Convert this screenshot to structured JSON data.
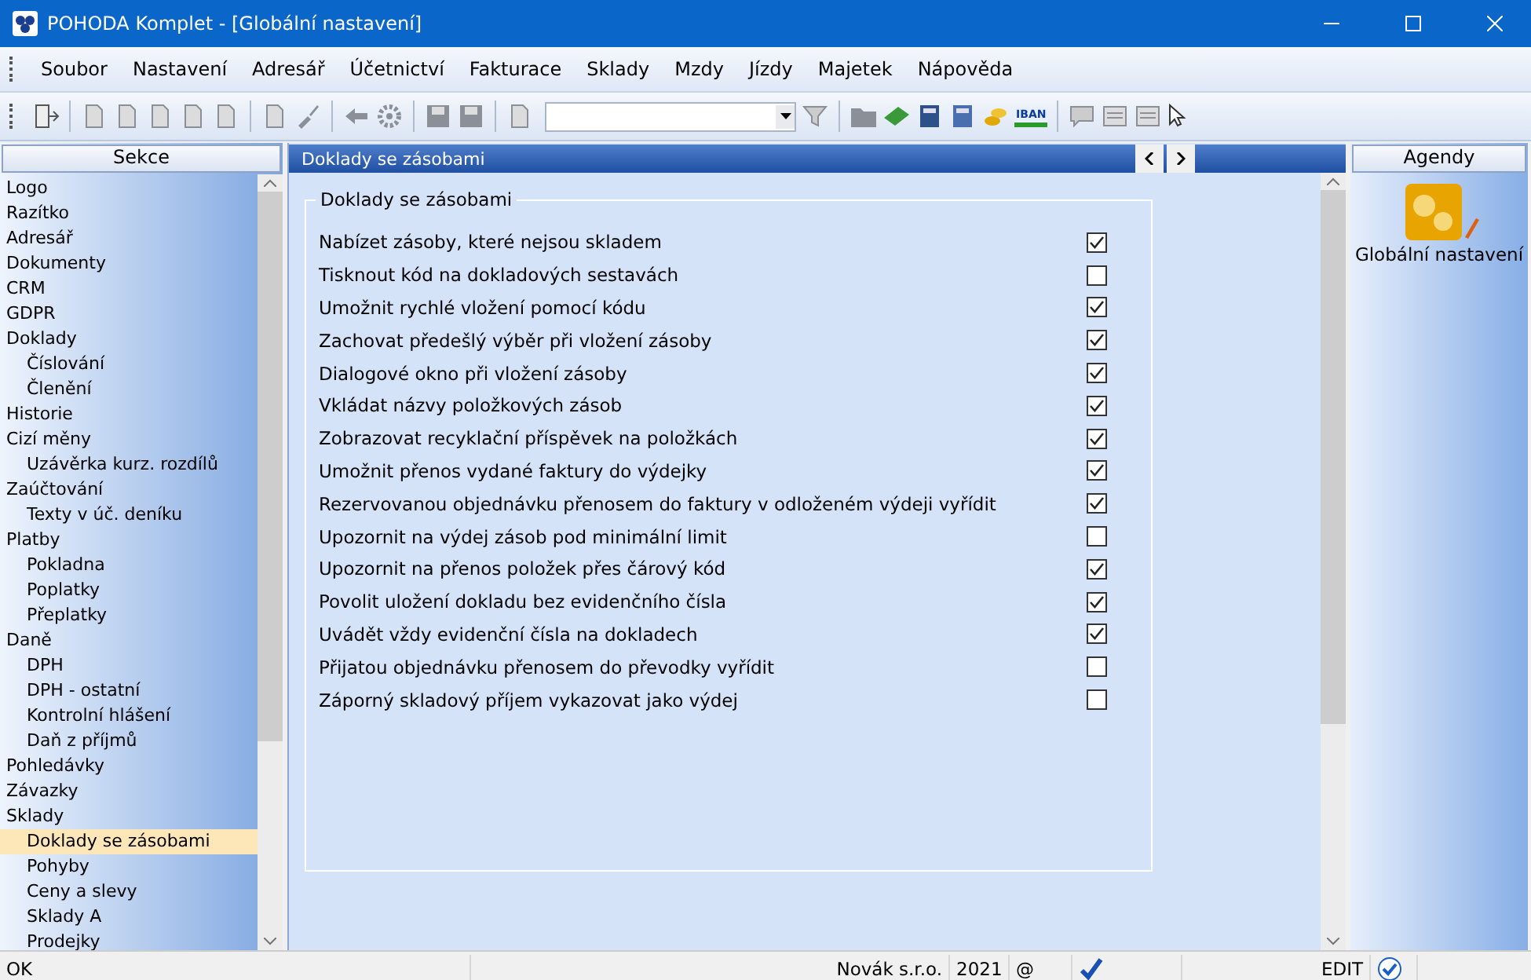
{
  "window": {
    "title": "POHODA Komplet - [Globální nastavení]"
  },
  "menu": [
    "Soubor",
    "Nastavení",
    "Adresář",
    "Účetnictví",
    "Fakturace",
    "Sklady",
    "Mzdy",
    "Jízdy",
    "Majetek",
    "Nápověda"
  ],
  "toolbar": {
    "iban_label": "IBAN"
  },
  "sidebar": {
    "title": "Sekce",
    "items": [
      {
        "label": "Logo",
        "selected": false
      },
      {
        "label": "Razítko",
        "selected": false
      },
      {
        "label": "Adresář",
        "selected": false
      },
      {
        "label": "Dokumenty",
        "selected": false
      },
      {
        "label": "CRM",
        "selected": false
      },
      {
        "label": "GDPR",
        "selected": false
      },
      {
        "label": "Doklady",
        "selected": false,
        "children": [
          {
            "label": "Číslování",
            "selected": false
          },
          {
            "label": "Členění",
            "selected": false
          }
        ]
      },
      {
        "label": "Historie",
        "selected": false
      },
      {
        "label": "Cizí měny",
        "selected": false,
        "children": [
          {
            "label": "Uzávěrka kurz. rozdílů",
            "selected": false
          }
        ]
      },
      {
        "label": "Zaúčtování",
        "selected": false,
        "children": [
          {
            "label": "Texty v úč. deníku",
            "selected": false
          }
        ]
      },
      {
        "label": "Platby",
        "selected": false,
        "children": [
          {
            "label": "Pokladna",
            "selected": false
          },
          {
            "label": "Poplatky",
            "selected": false
          },
          {
            "label": "Přeplatky",
            "selected": false
          }
        ]
      },
      {
        "label": "Daně",
        "selected": false,
        "children": [
          {
            "label": "DPH",
            "selected": false
          },
          {
            "label": "DPH - ostatní",
            "selected": false
          },
          {
            "label": "Kontrolní hlášení",
            "selected": false
          },
          {
            "label": "Daň z příjmů",
            "selected": false
          }
        ]
      },
      {
        "label": "Pohledávky",
        "selected": false
      },
      {
        "label": "Závazky",
        "selected": false
      },
      {
        "label": "Sklady",
        "selected": false,
        "children": [
          {
            "label": "Doklady se zásobami",
            "selected": true
          },
          {
            "label": "Pohyby",
            "selected": false
          },
          {
            "label": "Ceny a slevy",
            "selected": false
          },
          {
            "label": "Sklady A",
            "selected": false
          },
          {
            "label": "Prodejky",
            "selected": false
          }
        ]
      }
    ]
  },
  "panel": {
    "title": "Doklady se zásobami",
    "group_title": "Doklady se zásobami",
    "options": [
      {
        "label": "Nabízet zásoby, které nejsou skladem",
        "checked": true
      },
      {
        "label": "Tisknout kód na dokladových sestavách",
        "checked": false
      },
      {
        "label": "Umožnit rychlé vložení pomocí kódu",
        "checked": true
      },
      {
        "label": "Zachovat předešlý výběr při vložení zásoby",
        "checked": true
      },
      {
        "label": "Dialogové okno při vložení zásoby",
        "checked": true
      },
      {
        "label": "Vkládat názvy položkových zásob",
        "checked": true
      },
      {
        "label": "Zobrazovat recyklační příspěvek na položkách",
        "checked": true
      },
      {
        "label": "Umožnit přenos vydané faktury do výdejky",
        "checked": true
      },
      {
        "label": "Rezervovanou objednávku přenosem do faktury v odloženém výdeji vyřídit",
        "checked": true
      },
      {
        "label": "Upozornit na výdej zásob pod minimální limit",
        "checked": false
      },
      {
        "label": "Upozornit na přenos položek přes čárový kód",
        "checked": true
      },
      {
        "label": "Povolit uložení dokladu bez evidenčního čísla",
        "checked": true
      },
      {
        "label": "Uvádět vždy evidenční čísla na dokladech",
        "checked": true
      },
      {
        "label": "Přijatou objednávku přenosem do převodky vyřídit",
        "checked": false
      },
      {
        "label": "Záporný skladový příjem vykazovat jako výdej",
        "checked": false
      }
    ]
  },
  "agendas": {
    "title": "Agendy",
    "items": [
      {
        "label": "Globální nastavení"
      }
    ]
  },
  "status_bar": {
    "message": "OK",
    "company": "Novák s.r.o.",
    "year": "2021",
    "email_sign": "@",
    "mode": "EDIT"
  }
}
